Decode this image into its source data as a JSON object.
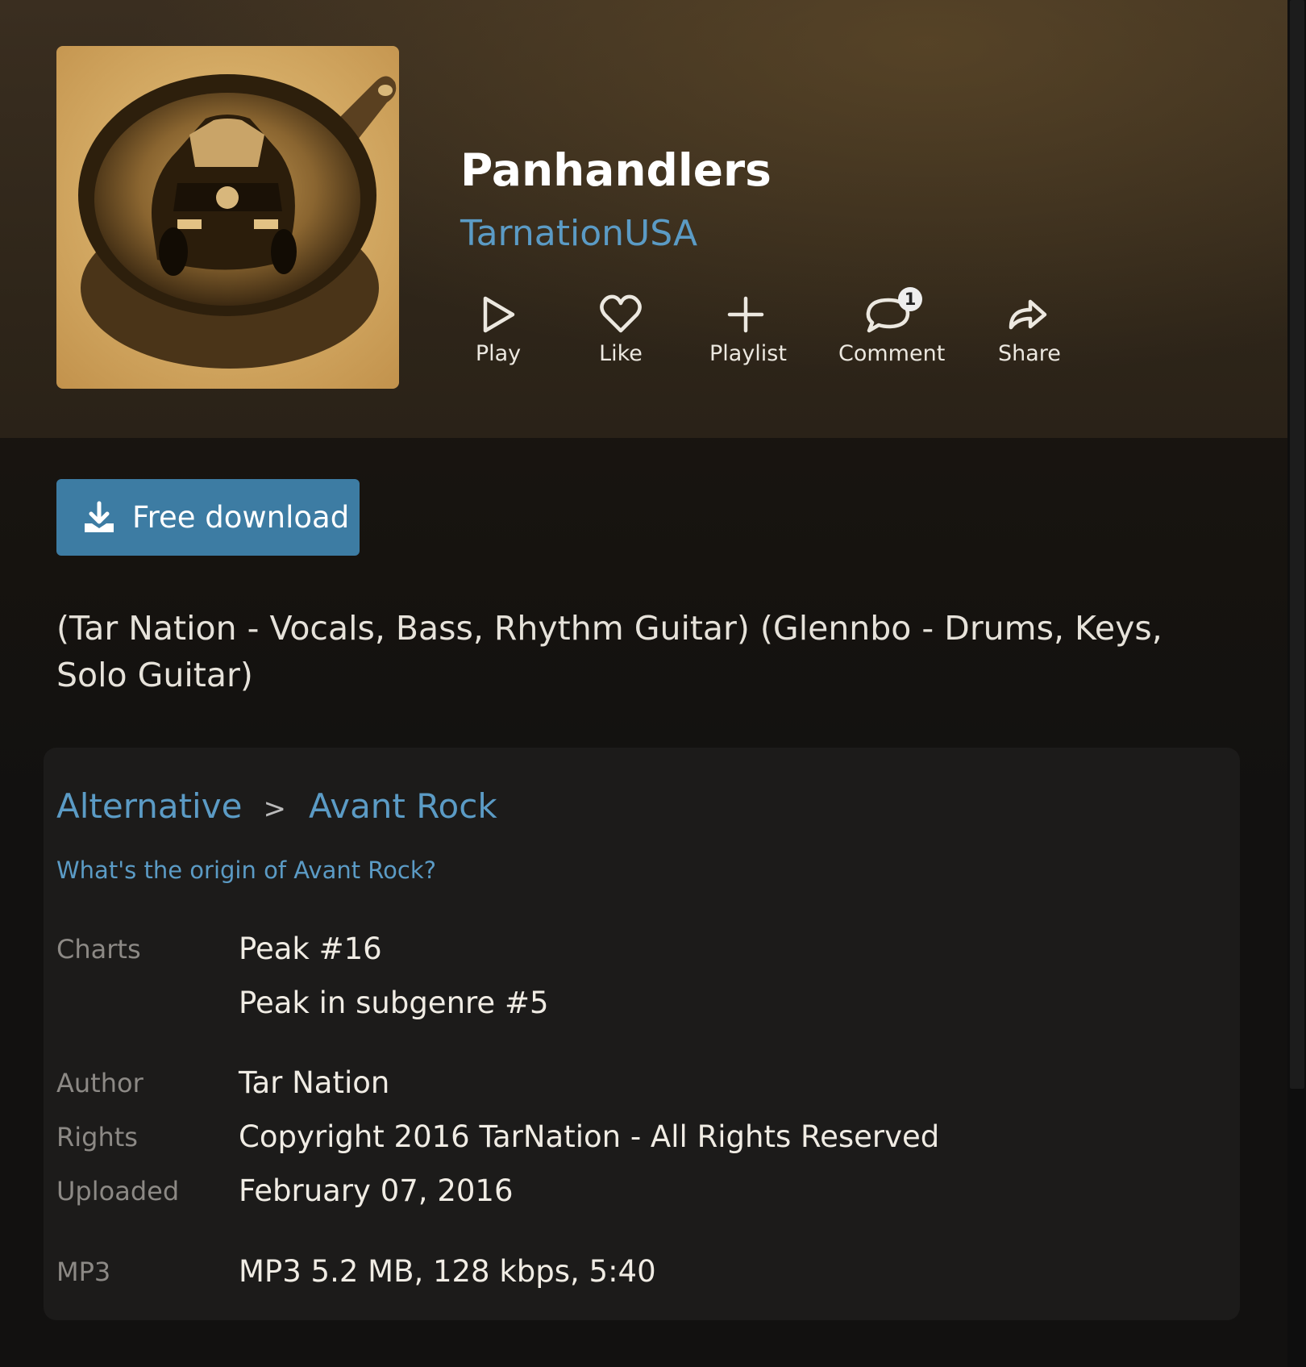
{
  "song": {
    "title": "Panhandlers",
    "artist": "TarnationUSA"
  },
  "actions": [
    {
      "label": "Play",
      "icon": "play-icon"
    },
    {
      "label": "Like",
      "icon": "heart-icon"
    },
    {
      "label": "Playlist",
      "icon": "plus-icon"
    },
    {
      "label": "Comment",
      "icon": "comment-icon",
      "badge": "1"
    },
    {
      "label": "Share",
      "icon": "share-icon"
    }
  ],
  "download": {
    "label": "Free download",
    "icon": "download-icon"
  },
  "description": "(Tar Nation - Vocals, Bass, Rhythm Guitar) (Glennbo - Drums, Keys, Solo Guitar)",
  "genre": {
    "parent": "Alternative",
    "separator": ">",
    "sub": "Avant Rock",
    "origin_link": "What's the origin of Avant Rock?"
  },
  "details": {
    "charts_label": "Charts",
    "charts_peak": "Peak #16",
    "charts_subgenre": "Peak in subgenre #5",
    "author_label": "Author",
    "author": "Tar Nation",
    "rights_label": "Rights",
    "rights": "Copyright 2016 TarNation - All Rights Reserved",
    "uploaded_label": "Uploaded",
    "uploaded": "February 07, 2016",
    "file_label": "MP3",
    "file_info": "MP3 5.2 MB, 128 kbps, 5:40"
  },
  "colors": {
    "link": "#5b9bc5",
    "download_button": "#3d7ca3",
    "card_bg": "#1c1b1a",
    "hero_bg": "#3a2e20"
  }
}
